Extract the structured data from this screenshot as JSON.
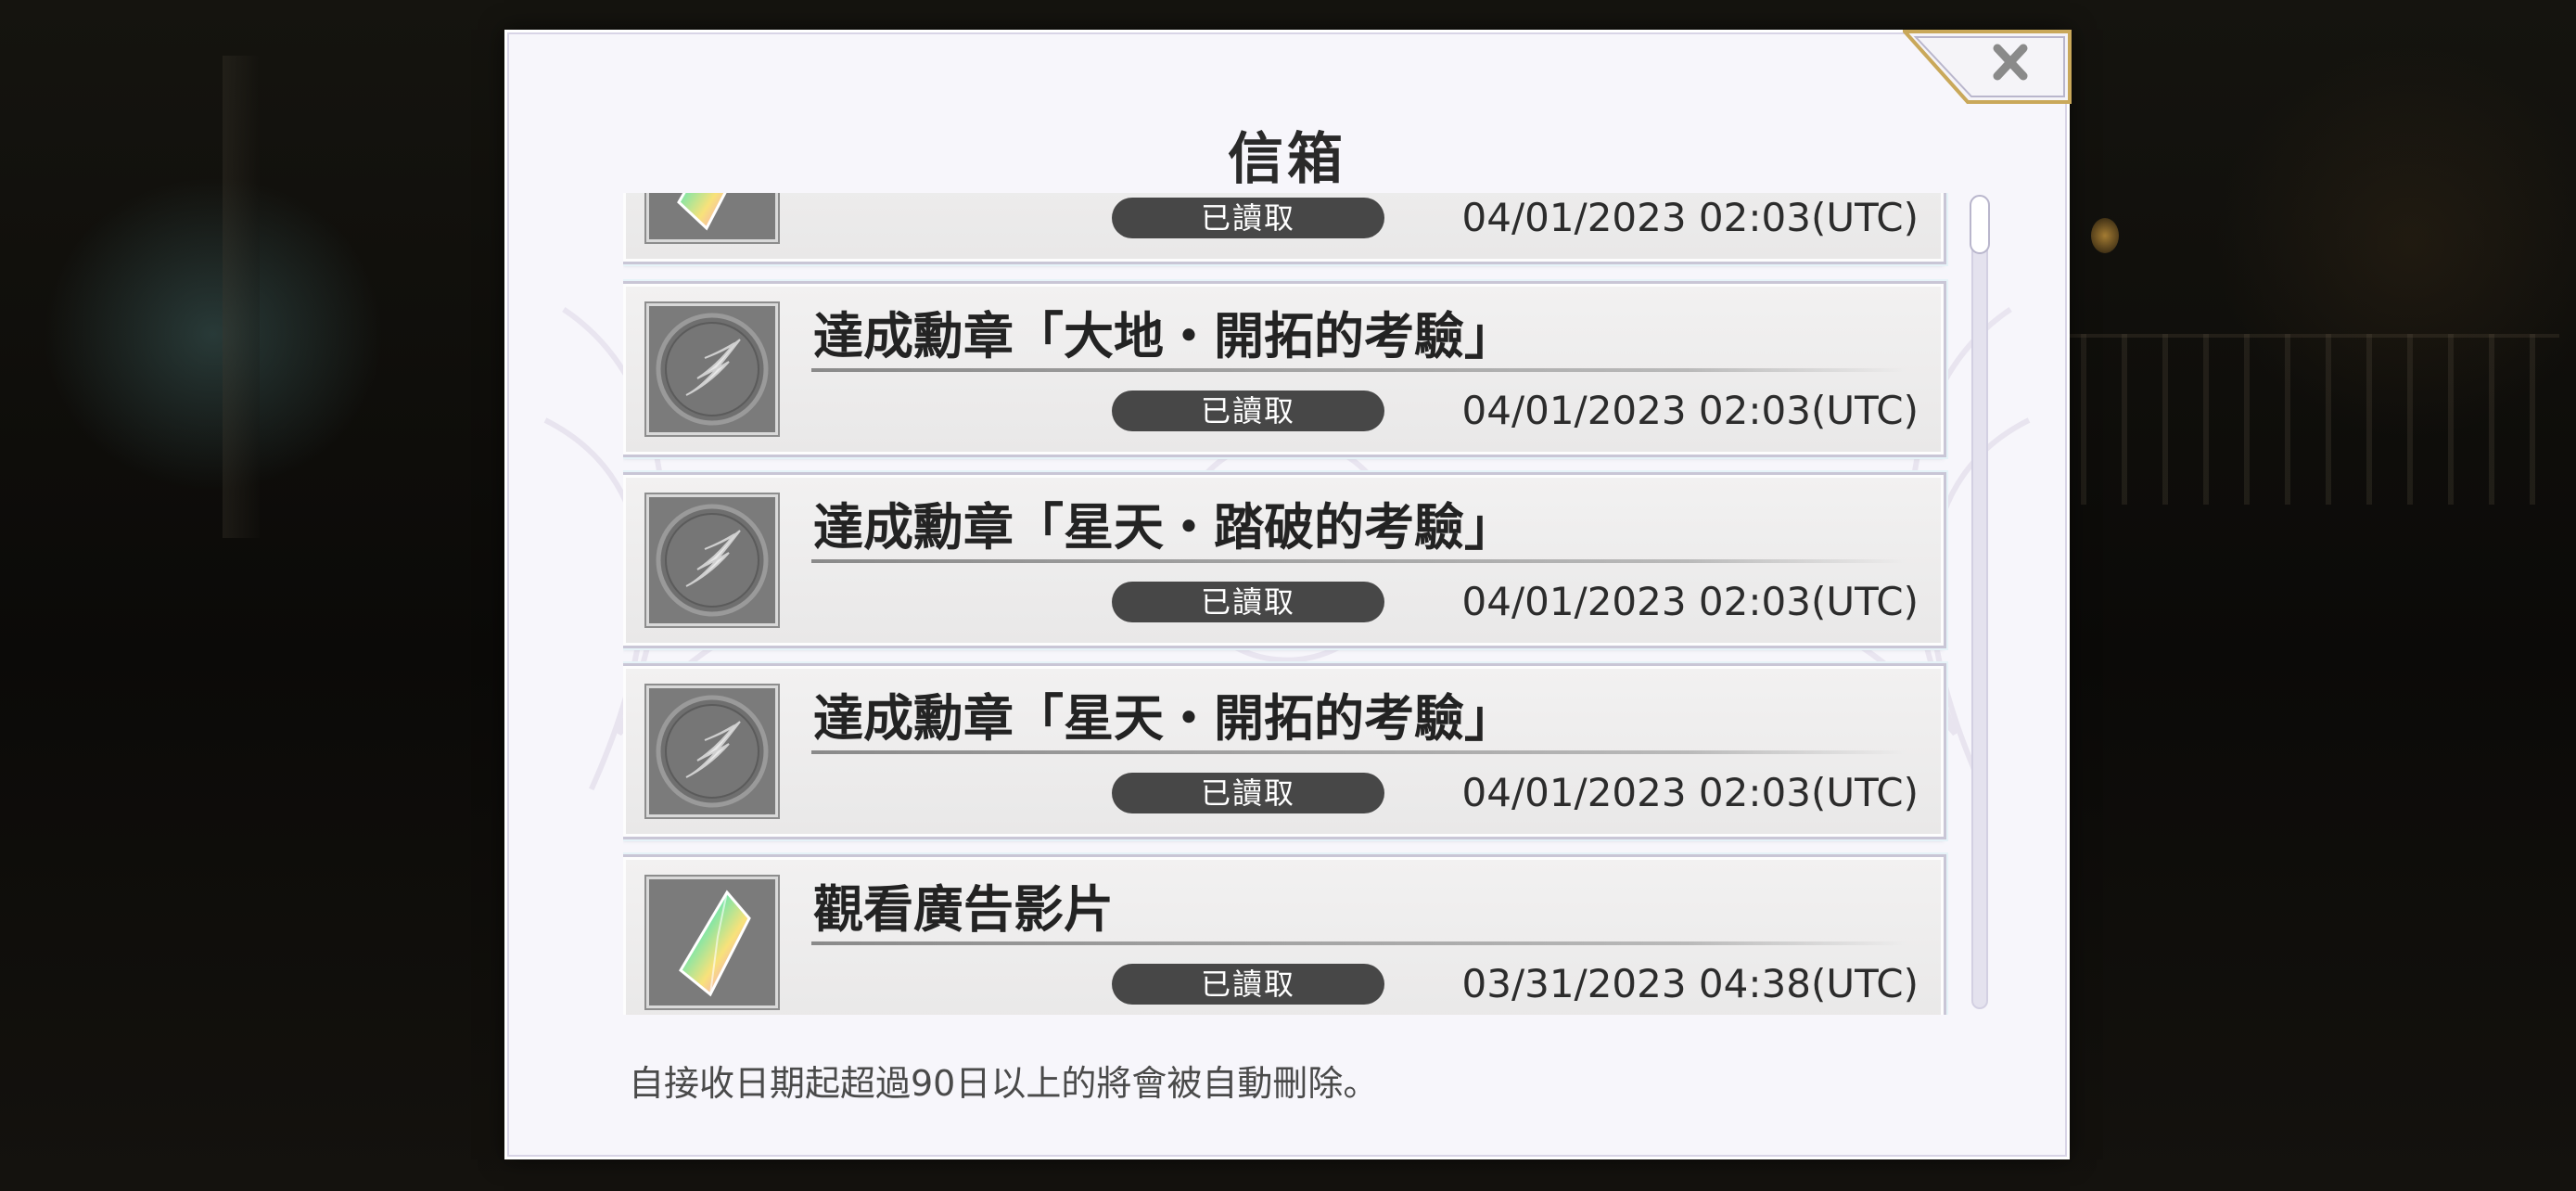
{
  "dialog": {
    "title": "信箱",
    "close_icon": "close-x-icon",
    "footer_note": "自接收日期起超過90日以上的將會被自動刪除。"
  },
  "mail_items": [
    {
      "icon": "rainbow-crystal-icon",
      "title": "",
      "status": "已讀取",
      "date": "04/01/2023 02:03(UTC)"
    },
    {
      "icon": "wing-medal-icon",
      "title": "達成勳章「大地・開拓的考驗」",
      "status": "已讀取",
      "date": "04/01/2023 02:03(UTC)"
    },
    {
      "icon": "wing-medal-icon",
      "title": "達成勳章「星天・踏破的考驗」",
      "status": "已讀取",
      "date": "04/01/2023 02:03(UTC)"
    },
    {
      "icon": "wing-medal-icon",
      "title": "達成勳章「星天・開拓的考驗」",
      "status": "已讀取",
      "date": "04/01/2023 02:03(UTC)"
    },
    {
      "icon": "rainbow-crystal-icon",
      "title": "觀看廣告影片",
      "status": "已讀取",
      "date": "03/31/2023 04:38(UTC)"
    }
  ],
  "colors": {
    "badge": "#474747",
    "panel": "#f7f6fb",
    "close_gold": "#c9a85a"
  }
}
